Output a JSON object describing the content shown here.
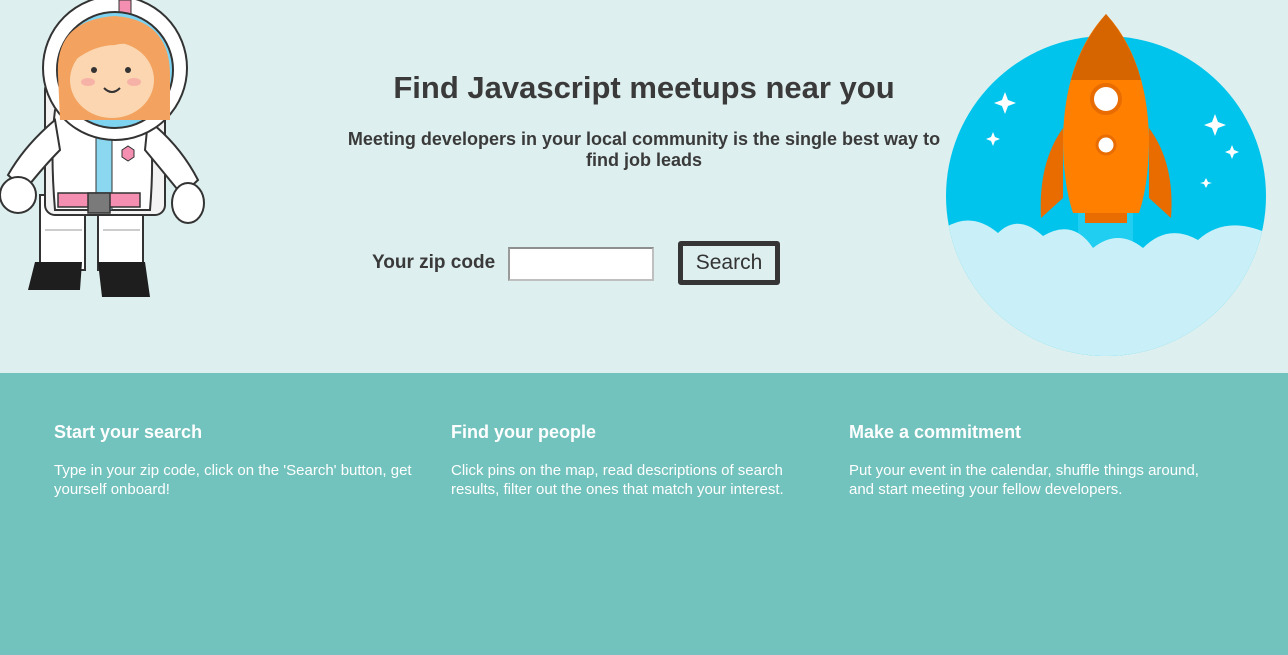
{
  "hero": {
    "title": "Find Javascript meetups near you",
    "subtitle": "Meeting developers in your local community is the single best way to find job leads"
  },
  "search": {
    "zip_label": "Your zip code",
    "zip_value": "",
    "button_label": "Search"
  },
  "features": [
    {
      "title": "Start your search",
      "text": "Type in your zip code, click on the 'Search' button, get yourself onboard!"
    },
    {
      "title": "Find your people",
      "text": "Click pins on the map, read descriptions of search results, filter out the ones that match your interest."
    },
    {
      "title": "Make a commitment",
      "text": "Put your event in the calendar, shuffle things around, and start meeting your fellow developers."
    }
  ],
  "colors": {
    "hero_bg": "#ddefee",
    "features_bg": "#72c2bd",
    "rocket_circle": "#00c4eb",
    "rocket_body": "#ff7f00"
  }
}
